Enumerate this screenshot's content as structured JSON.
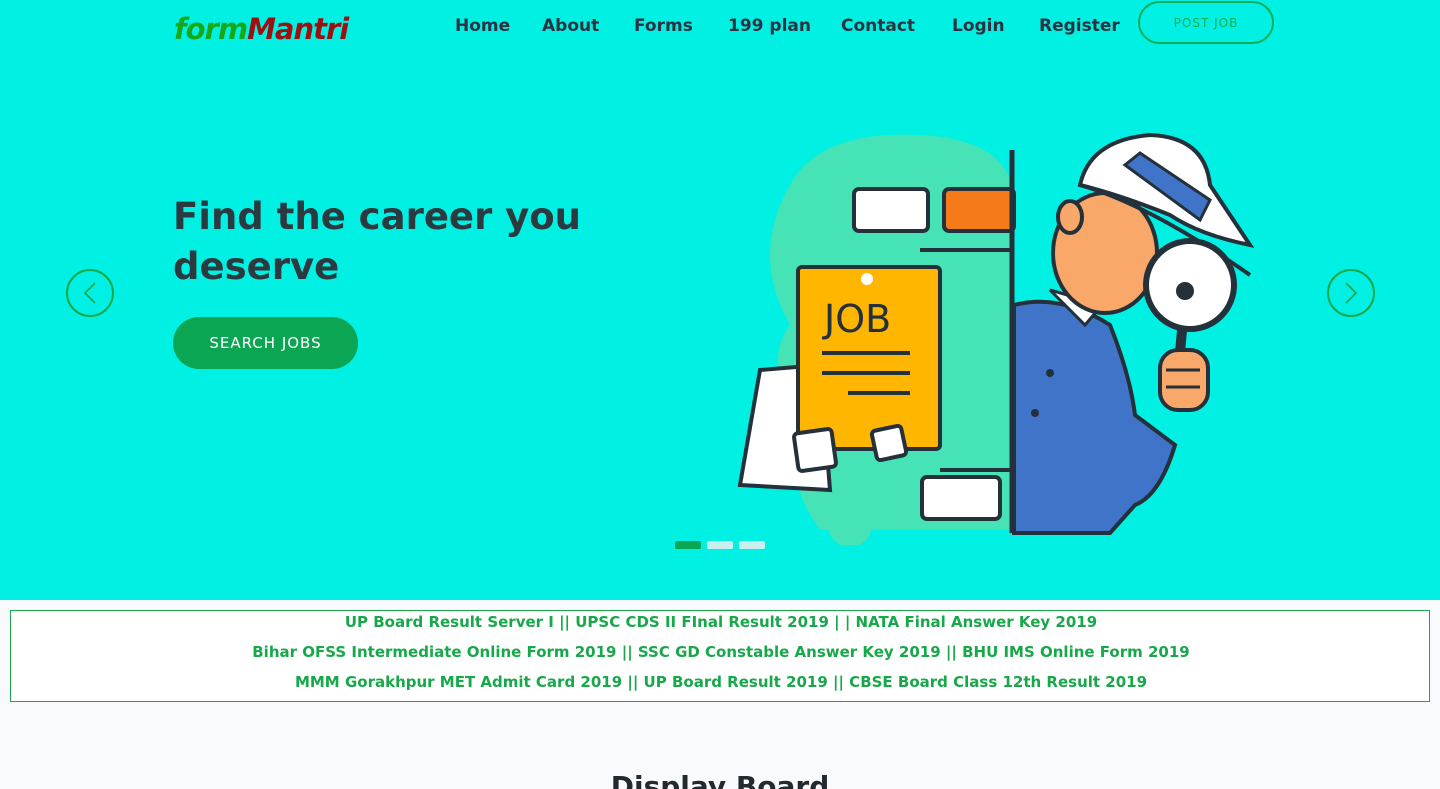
{
  "brand": {
    "part1": "form",
    "part2": "Mantri"
  },
  "nav": {
    "items": [
      {
        "label": "Home"
      },
      {
        "label": "About"
      },
      {
        "label": "Forms"
      },
      {
        "label": "199 plan"
      },
      {
        "label": "Contact"
      },
      {
        "label": "Login"
      },
      {
        "label": "Register"
      }
    ],
    "post_job": "POST JOB"
  },
  "hero": {
    "headline_line1": "Find the career you",
    "headline_line2": "deserve",
    "cta": "SEARCH JOBS",
    "illustration_text": "JOB",
    "carousel": {
      "slides": 3,
      "active": 1
    }
  },
  "ticker": {
    "lines": [
      "UP Board Result Server I || UPSC CDS II FInal Result 2019 | | NATA Final Answer Key 2019",
      "Bihar OFSS Intermediate Online Form 2019 || SSC GD Constable Answer Key 2019 || BHU IMS Online Form 2019",
      "MMM Gorakhpur MET Admit Card 2019 || UP Board Result 2019 || CBSE Board Class 12th Result 2019"
    ]
  },
  "section": {
    "title": "Display Board"
  },
  "colors": {
    "hero_bg": "#00f0e4",
    "accent_green": "#0aa653",
    "text_dark": "#2a3a3f"
  }
}
